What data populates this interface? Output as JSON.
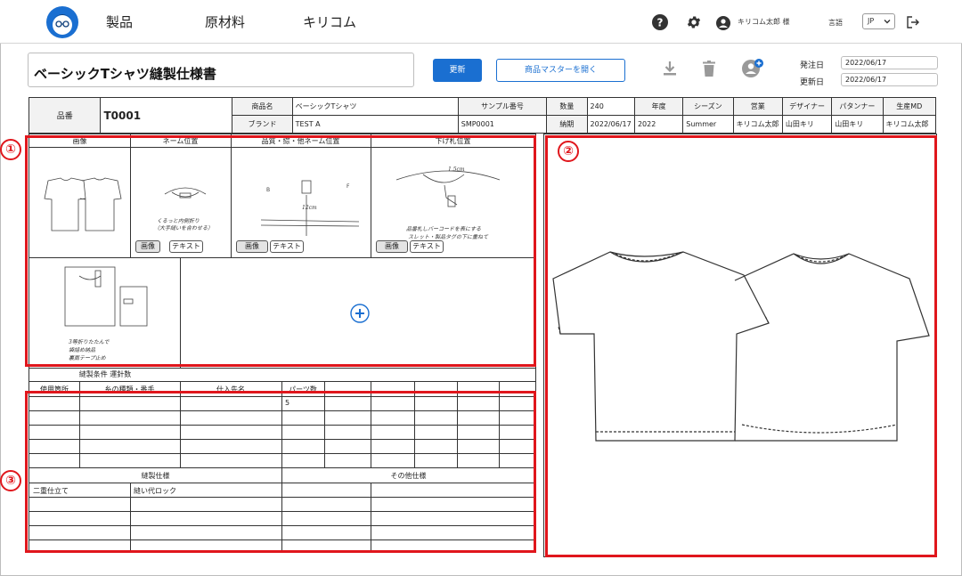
{
  "nav": {
    "links": [
      "製品",
      "原材料",
      "キリコム"
    ],
    "username": "キリコム太郎 様",
    "language_label": "言語",
    "language_value": "JP"
  },
  "header": {
    "title": "ベーシックTシャツ縫製仕様書",
    "update_button": "更新",
    "master_button": "商品マスターを開く",
    "order_date_label": "発注日",
    "order_date": "2022/06/17",
    "updated_date_label": "更新日",
    "updated_date": "2022/06/17"
  },
  "info": {
    "item_no_label": "品番",
    "item_no": "T0001",
    "product_name_label": "商品名",
    "product_name": "ベーシックTシャツ",
    "brand_label": "ブランド",
    "brand": "TEST A",
    "sample_no_label": "サンプル番号",
    "sample_no": "SMP0001",
    "quantity_label": "数量",
    "quantity": "240",
    "deadline_label": "納期",
    "deadline": "2022/06/17",
    "year_label": "年度",
    "year": "2022",
    "season_label": "シーズン",
    "season": "Summer",
    "sales_label": "営業",
    "sales": "キリコム太郎",
    "designer_label": "デザイナー",
    "designer": "山田キリ",
    "patterner_label": "パタンナー",
    "patterner": "山田キリ",
    "production_md_label": "生産MD",
    "production_md": "キリコム太郎"
  },
  "images": {
    "headers": [
      "画像",
      "ネーム位置",
      "品質・綜・他ネーム位置",
      "下げ札位置"
    ],
    "image_button": "画像",
    "text_button": "テキスト",
    "notes": {
      "name_pos": [
        "くるっと内側折り",
        "（大手縫いを合わせる）"
      ],
      "tag_pos": [
        "品番札しバーコードを表にする",
        "スレット・製品タグの下に重ねて"
      ],
      "packing": [
        "3等折りたたんで",
        "袋詰め納品",
        "裏面テープ止め"
      ],
      "measure": "1.5cm",
      "dim": "12cm"
    }
  },
  "sewing": {
    "conditions_label": "縫製条件 運針数",
    "columns": [
      "使用箇所",
      "糸の種類・番手",
      "仕入先名",
      "パーツ数"
    ],
    "parts_value": "5",
    "spec_label": "縫製仕様",
    "other_label": "その他仕様",
    "spec_rows": [
      [
        "二重仕立て",
        "縫い代ロック"
      ]
    ]
  },
  "markers": [
    "①",
    "②",
    "③"
  ],
  "colors": {
    "accent": "#1a6fd1",
    "highlight": "#e0161c"
  },
  "icons": [
    "help-icon",
    "gear-icon",
    "user-icon",
    "logout-icon",
    "download-icon",
    "trash-icon",
    "add-user-icon",
    "plus-icon",
    "chevron-down-icon"
  ]
}
